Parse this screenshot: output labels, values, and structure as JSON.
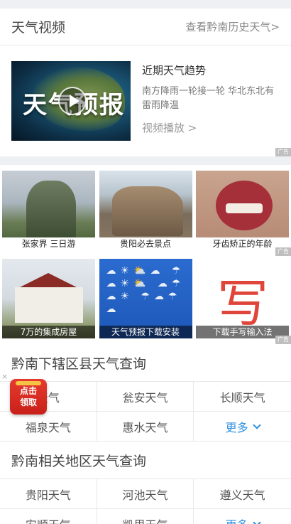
{
  "video_section": {
    "title": "天气视频",
    "history_link": "查看黔南历史天气>",
    "feature": {
      "thumb_text": "天气预报",
      "title": "近期天气趋势",
      "description": "南方降雨一轮接一轮 华北东北有雷雨降温",
      "play": "视频播放 >"
    },
    "ad_label": "广告"
  },
  "ads_row1": [
    {
      "caption": "张家界 三日游"
    },
    {
      "caption": "贵阳必去景点"
    },
    {
      "caption": "牙齿矫正的年龄"
    }
  ],
  "ads_row2": [
    {
      "caption": "7万的集成房屋"
    },
    {
      "caption": "天气预报下载安装"
    },
    {
      "caption": "下载手写输入法"
    }
  ],
  "county_section": {
    "title": "黔南下辖区县天气查询",
    "cells": [
      "天气",
      "瓮安天气",
      "长顺天气",
      "福泉天气",
      "惠水天气",
      "更多"
    ]
  },
  "related_section": {
    "title": "黔南相关地区天气查询",
    "cells": [
      "贵阳天气",
      "河池天气",
      "遵义天气",
      "安顺天气",
      "凯里天气",
      "更多"
    ]
  },
  "floating_badge": {
    "line1": "点击",
    "line2": "领取",
    "close": "×"
  }
}
